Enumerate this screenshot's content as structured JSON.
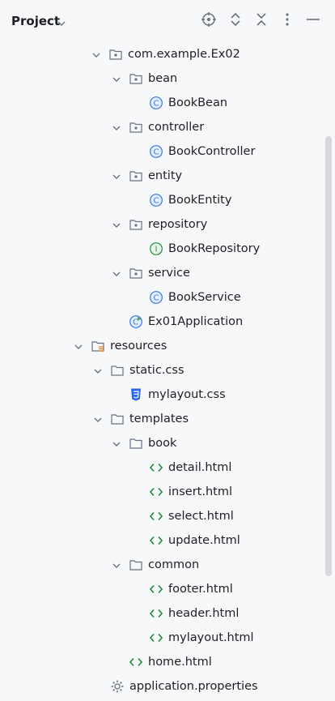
{
  "header": {
    "title": "Project",
    "icons": [
      "locate-icon",
      "expand-all-icon",
      "collapse-all-icon",
      "more-options-icon",
      "minimize-icon"
    ]
  },
  "tree": [
    {
      "label": "com.example.Ex02",
      "kind": "package",
      "expanded": true
    },
    {
      "label": "bean",
      "kind": "package",
      "expanded": true
    },
    {
      "label": "BookBean",
      "kind": "class"
    },
    {
      "label": "controller",
      "kind": "package",
      "expanded": true
    },
    {
      "label": "BookController",
      "kind": "class"
    },
    {
      "label": "entity",
      "kind": "package",
      "expanded": true
    },
    {
      "label": "BookEntity",
      "kind": "class"
    },
    {
      "label": "repository",
      "kind": "package",
      "expanded": true
    },
    {
      "label": "BookRepository",
      "kind": "interface"
    },
    {
      "label": "service",
      "kind": "package",
      "expanded": true
    },
    {
      "label": "BookService",
      "kind": "class"
    },
    {
      "label": "Ex01Application",
      "kind": "spring-app"
    },
    {
      "label": "resources",
      "kind": "resources-folder",
      "expanded": true
    },
    {
      "label": "static.css",
      "kind": "folder",
      "expanded": true
    },
    {
      "label": "mylayout.css",
      "kind": "css"
    },
    {
      "label": "templates",
      "kind": "folder",
      "expanded": true
    },
    {
      "label": "book",
      "kind": "folder",
      "expanded": true
    },
    {
      "label": "detail.html",
      "kind": "html"
    },
    {
      "label": "insert.html",
      "kind": "html"
    },
    {
      "label": "select.html",
      "kind": "html"
    },
    {
      "label": "update.html",
      "kind": "html"
    },
    {
      "label": "common",
      "kind": "folder",
      "expanded": true
    },
    {
      "label": "footer.html",
      "kind": "html"
    },
    {
      "label": "header.html",
      "kind": "html"
    },
    {
      "label": "mylayout.html",
      "kind": "html"
    },
    {
      "label": "home.html",
      "kind": "html"
    },
    {
      "label": "application.properties",
      "kind": "properties"
    }
  ]
}
